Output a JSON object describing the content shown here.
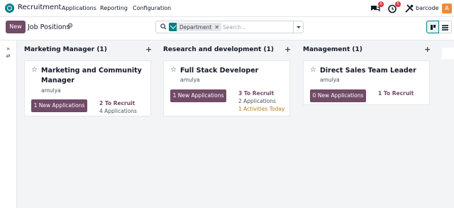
{
  "navbar": {
    "app_name": "Recruitment",
    "menus": [
      "Applications",
      "Reporting",
      "Configuration"
    ],
    "messages_badge": "6",
    "activities_badge": "5",
    "company": "barcode",
    "avatar_initial": "A"
  },
  "control": {
    "new_label": "New",
    "page_title": "Job Positions",
    "search": {
      "facet_label": "Department",
      "placeholder": "Search..."
    }
  },
  "columns": [
    {
      "title": "Marketing Manager (1)",
      "card": {
        "title": "Marketing and Community Manager",
        "user": "amulya",
        "button": "1 New Applications",
        "to_recruit": "2 To Recruit",
        "applications": "4 Applications",
        "activities": ""
      }
    },
    {
      "title": "Research and development (1)",
      "card": {
        "title": "Full Stack Developer",
        "user": "amulya",
        "button": "1 New Applications",
        "to_recruit": "3 To Recruit",
        "applications": "2 Applications",
        "activities": "1 Activities Today"
      }
    },
    {
      "title": "Management (1)",
      "card": {
        "title": "Direct Sales Team Leader",
        "user": "amulya",
        "button": "0 New Applications",
        "to_recruit": "1 To Recruit",
        "applications": "",
        "activities": ""
      }
    }
  ],
  "colors": {
    "brand": "#714b67",
    "accent": "#017e84",
    "badge": "#d9363e",
    "warning": "#b67a15"
  }
}
